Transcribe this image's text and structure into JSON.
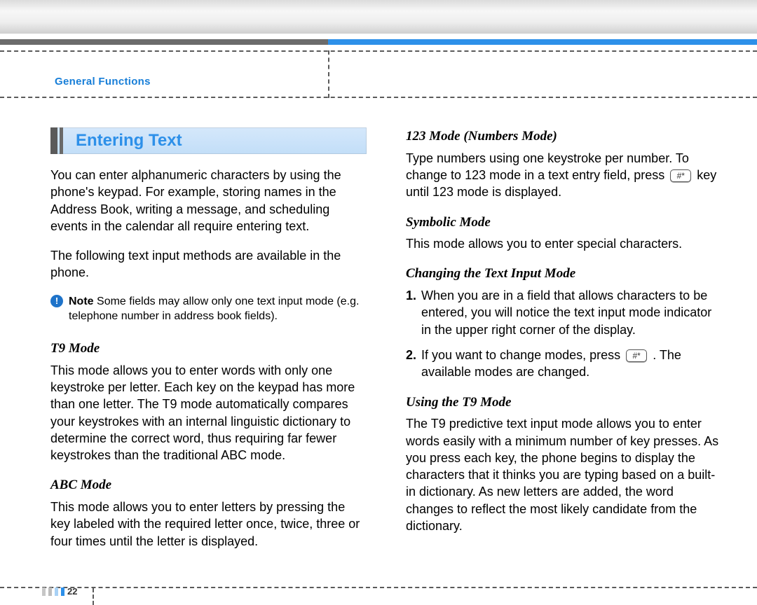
{
  "section_label": "General Functions",
  "page_number": "22",
  "heading": "Entering Text",
  "left": {
    "intro1": "You can enter alphanumeric characters by using the phone's keypad. For example, storing names in the Address Book, writing a message, and scheduling events in the calendar all require entering text.",
    "intro2": "The following text input methods are available in the phone.",
    "note_label": "Note",
    "note_body": "Some fields may allow only one text input mode (e.g. telephone number in address book fields).",
    "t9_h": "T9 Mode",
    "t9_body": "This mode allows you to enter words with only one keystroke per letter. Each key on the keypad has more than one letter. The T9 mode automatically compares your keystrokes with an internal linguistic dictionary to determine the correct word, thus requiring far fewer keystrokes than the traditional ABC mode.",
    "abc_h": "ABC Mode",
    "abc_body": "This mode allows you to enter letters by pressing the key labeled with the required letter once, twice, three or four times until the letter is displayed."
  },
  "right": {
    "num_h": "123 Mode (Numbers Mode)",
    "num_body_a": "Type numbers using one keystroke per number. To change to 123 mode in a text entry field, press ",
    "num_body_b": " key until 123 mode is displayed.",
    "sym_h": "Symbolic Mode",
    "sym_body": "This mode allows you to enter special characters.",
    "chg_h": "Changing the Text Input Mode",
    "chg_1": "When you are in a field that allows characters to be entered, you will notice the text input mode indicator in the upper right corner of the display.",
    "chg_2a": "If you want to change modes, press ",
    "chg_2b": " . The available modes are changed.",
    "use_h": "Using the T9 Mode",
    "use_body": "The T9 predictive text input mode allows you to enter words easily with a minimum number of key presses. As you press each key, the phone begins to display the characters that it thinks you are typing based on a built-in dictionary. As new letters are added, the word changes to reflect the most likely candidate from the dictionary."
  },
  "key_label": "#*"
}
